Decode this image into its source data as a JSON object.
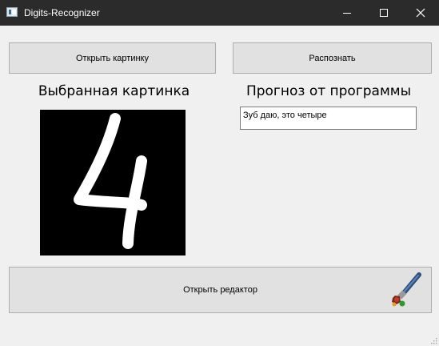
{
  "window": {
    "title": "Digits-Recognizer"
  },
  "toolbar": {
    "open_image_label": "Открыть картинку",
    "recognize_label": "Распознать"
  },
  "main": {
    "selected_image_heading": "Выбранная картинка",
    "prediction_heading": "Прогноз от программы",
    "prediction_text": "Зуб даю, это четыре"
  },
  "editor": {
    "open_editor_label": "Открыть редактор",
    "icon": "paintbrush-icon"
  },
  "icons": [
    "app-icon",
    "minimize-icon",
    "maximize-icon",
    "close-icon",
    "paintbrush-icon",
    "resize-grip-icon"
  ],
  "colors": {
    "titlebar": "#2b2b2b",
    "background": "#f0f0f0",
    "button_face": "#e1e1e1",
    "digit_background": "#000000",
    "digit_stroke": "#ffffff"
  }
}
